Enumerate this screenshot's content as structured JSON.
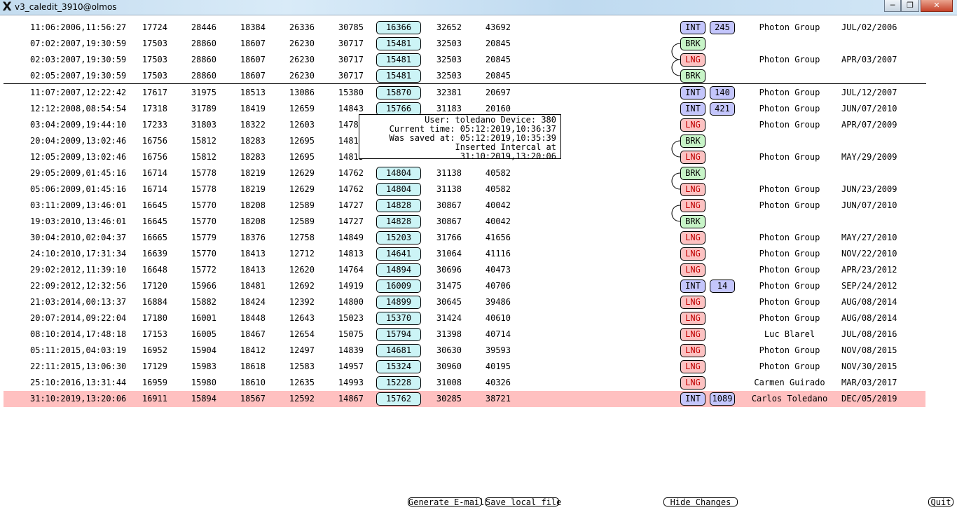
{
  "window": {
    "title": "v3_caledit_3910@olmos",
    "logo": "X",
    "min_icon": "minimize-icon",
    "max_icon": "maximize-icon",
    "close_icon": "close-icon"
  },
  "rows": [
    {
      "date": "11:06:2006,11:56:27",
      "v1": "17724",
      "v2": "28446",
      "v3": "18384",
      "v4": "26336",
      "v5": "30785",
      "box": "16366",
      "v7": "32652",
      "v8": "43692",
      "tag": "INT",
      "num": "245",
      "group": "Photon Group",
      "mdate": "JUL/02/2006"
    },
    {
      "date": "07:02:2007,19:30:59",
      "v1": "17503",
      "v2": "28860",
      "v3": "18607",
      "v4": "26230",
      "v5": "30717",
      "box": "15481",
      "v7": "32503",
      "v8": "20845",
      "tag": "BRK",
      "num": "",
      "group": "",
      "mdate": ""
    },
    {
      "date": "02:03:2007,19:30:59",
      "v1": "17503",
      "v2": "28860",
      "v3": "18607",
      "v4": "26230",
      "v5": "30717",
      "box": "15481",
      "v7": "32503",
      "v8": "20845",
      "tag": "LNG",
      "num": "",
      "group": "Photon Group",
      "mdate": "APR/03/2007"
    },
    {
      "date": "02:05:2007,19:30:59",
      "v1": "17503",
      "v2": "28860",
      "v3": "18607",
      "v4": "26230",
      "v5": "30717",
      "box": "15481",
      "v7": "32503",
      "v8": "20845",
      "tag": "BRK",
      "num": "",
      "group": "",
      "mdate": ""
    },
    {
      "date": "11:07:2007,12:22:42",
      "v1": "17617",
      "v2": "31975",
      "v3": "18513",
      "v4": "13086",
      "v5": "15380",
      "box": "15870",
      "v7": "32381",
      "v8": "20697",
      "tag": "INT",
      "num": "140",
      "group": "Photon Group",
      "mdate": "JUL/12/2007"
    },
    {
      "date": "12:12:2008,08:54:54",
      "v1": "17318",
      "v2": "31789",
      "v3": "18419",
      "v4": "12659",
      "v5": "14843",
      "box": "15766",
      "v7": "31183",
      "v8": "20160",
      "tag": "INT",
      "num": "421",
      "group": "Photon Group",
      "mdate": "JUN/07/2010"
    },
    {
      "date": "03:04:2009,19:44:10",
      "v1": "17233",
      "v2": "31803",
      "v3": "18322",
      "v4": "12603",
      "v5": "14783",
      "box": "",
      "v7": "",
      "v8": "",
      "tag": "LNG",
      "num": "",
      "group": "Photon Group",
      "mdate": "APR/07/2009"
    },
    {
      "date": "20:04:2009,13:02:46",
      "v1": "16756",
      "v2": "15812",
      "v3": "18283",
      "v4": "12695",
      "v5": "14813",
      "box": "",
      "v7": "",
      "v8": "",
      "tag": "BRK",
      "num": "",
      "group": "",
      "mdate": ""
    },
    {
      "date": "12:05:2009,13:02:46",
      "v1": "16756",
      "v2": "15812",
      "v3": "18283",
      "v4": "12695",
      "v5": "14813",
      "box": "",
      "v7": "",
      "v8": "",
      "tag": "LNG",
      "num": "",
      "group": "Photon Group",
      "mdate": "MAY/29/2009"
    },
    {
      "date": "29:05:2009,01:45:16",
      "v1": "16714",
      "v2": "15778",
      "v3": "18219",
      "v4": "12629",
      "v5": "14762",
      "box": "14804",
      "v7": "31138",
      "v8": "40582",
      "tag": "BRK",
      "num": "",
      "group": "",
      "mdate": ""
    },
    {
      "date": "05:06:2009,01:45:16",
      "v1": "16714",
      "v2": "15778",
      "v3": "18219",
      "v4": "12629",
      "v5": "14762",
      "box": "14804",
      "v7": "31138",
      "v8": "40582",
      "tag": "LNG",
      "num": "",
      "group": "Photon Group",
      "mdate": "JUN/23/2009"
    },
    {
      "date": "03:11:2009,13:46:01",
      "v1": "16645",
      "v2": "15770",
      "v3": "18208",
      "v4": "12589",
      "v5": "14727",
      "box": "14828",
      "v7": "30867",
      "v8": "40042",
      "tag": "LNG",
      "num": "",
      "group": "Photon Group",
      "mdate": "JUN/07/2010"
    },
    {
      "date": "19:03:2010,13:46:01",
      "v1": "16645",
      "v2": "15770",
      "v3": "18208",
      "v4": "12589",
      "v5": "14727",
      "box": "14828",
      "v7": "30867",
      "v8": "40042",
      "tag": "BRK",
      "num": "",
      "group": "",
      "mdate": ""
    },
    {
      "date": "30:04:2010,02:04:37",
      "v1": "16665",
      "v2": "15779",
      "v3": "18376",
      "v4": "12758",
      "v5": "14849",
      "box": "15203",
      "v7": "31766",
      "v8": "41656",
      "tag": "LNG",
      "num": "",
      "group": "Photon Group",
      "mdate": "MAY/27/2010"
    },
    {
      "date": "24:10:2010,17:31:34",
      "v1": "16639",
      "v2": "15770",
      "v3": "18413",
      "v4": "12712",
      "v5": "14813",
      "box": "14641",
      "v7": "31064",
      "v8": "41116",
      "tag": "LNG",
      "num": "",
      "group": "Photon Group",
      "mdate": "NOV/22/2010"
    },
    {
      "date": "29:02:2012,11:39:10",
      "v1": "16648",
      "v2": "15772",
      "v3": "18413",
      "v4": "12620",
      "v5": "14764",
      "box": "14894",
      "v7": "30696",
      "v8": "40473",
      "tag": "LNG",
      "num": "",
      "group": "Photon Group",
      "mdate": "APR/23/2012"
    },
    {
      "date": "22:09:2012,12:32:56",
      "v1": "17120",
      "v2": "15966",
      "v3": "18481",
      "v4": "12692",
      "v5": "14919",
      "box": "16009",
      "v7": "31475",
      "v8": "40706",
      "tag": "INT",
      "num": "14",
      "group": "Photon Group",
      "mdate": "SEP/24/2012"
    },
    {
      "date": "21:03:2014,00:13:37",
      "v1": "16884",
      "v2": "15882",
      "v3": "18424",
      "v4": "12392",
      "v5": "14800",
      "box": "14899",
      "v7": "30645",
      "v8": "39486",
      "tag": "LNG",
      "num": "",
      "group": "Photon Group",
      "mdate": "AUG/08/2014"
    },
    {
      "date": "20:07:2014,09:22:04",
      "v1": "17180",
      "v2": "16001",
      "v3": "18448",
      "v4": "12643",
      "v5": "15023",
      "box": "15370",
      "v7": "31424",
      "v8": "40610",
      "tag": "LNG",
      "num": "",
      "group": "Photon Group",
      "mdate": "AUG/08/2014"
    },
    {
      "date": "08:10:2014,17:48:18",
      "v1": "17153",
      "v2": "16005",
      "v3": "18467",
      "v4": "12654",
      "v5": "15075",
      "box": "15794",
      "v7": "31398",
      "v8": "40714",
      "tag": "LNG",
      "num": "",
      "group": "Luc Blarel",
      "mdate": "JUL/08/2016"
    },
    {
      "date": "05:11:2015,04:03:19",
      "v1": "16952",
      "v2": "15904",
      "v3": "18412",
      "v4": "12497",
      "v5": "14839",
      "box": "14681",
      "v7": "30630",
      "v8": "39593",
      "tag": "LNG",
      "num": "",
      "group": "Photon Group",
      "mdate": "NOV/08/2015"
    },
    {
      "date": "22:11:2015,13:06:30",
      "v1": "17129",
      "v2": "15983",
      "v3": "18618",
      "v4": "12583",
      "v5": "14957",
      "box": "15324",
      "v7": "30960",
      "v8": "40195",
      "tag": "LNG",
      "num": "",
      "group": "Photon Group",
      "mdate": "NOV/30/2015"
    },
    {
      "date": "25:10:2016,13:31:44",
      "v1": "16959",
      "v2": "15980",
      "v3": "18610",
      "v4": "12635",
      "v5": "14993",
      "box": "15228",
      "v7": "31008",
      "v8": "40326",
      "tag": "LNG",
      "num": "",
      "group": "Carmen Guirado",
      "mdate": "MAR/03/2017"
    },
    {
      "date": "31:10:2019,13:20:06",
      "v1": "16911",
      "v2": "15894",
      "v3": "18567",
      "v4": "12592",
      "v5": "14867",
      "box": "15762",
      "v7": "30285",
      "v8": "38721",
      "tag": "INT",
      "num": "1089",
      "group": "Carlos Toledano",
      "mdate": "DEC/05/2019",
      "highlight": true
    }
  ],
  "tooltip": {
    "line1": "User: toledano Device: 380",
    "line2": "Current time: 05:12:2019,10:36:37",
    "line3": "Was saved at: 05:12:2019,10:35:39",
    "line4": "Inserted Intercal at 31:10:2019,13:20:06"
  },
  "buttons": {
    "email": "Generate E-mail",
    "save": "Save local file",
    "hide": "Hide Changes",
    "quit": "Quit"
  },
  "colors": {
    "int_tag": "#c4c6fc",
    "brk_tag": "#c7f4c7",
    "lng_tag": "#fcc2c2",
    "lng_text": "#c00000",
    "value_box": "#ccf4f6",
    "highlight_row": "#ffc0c0"
  }
}
